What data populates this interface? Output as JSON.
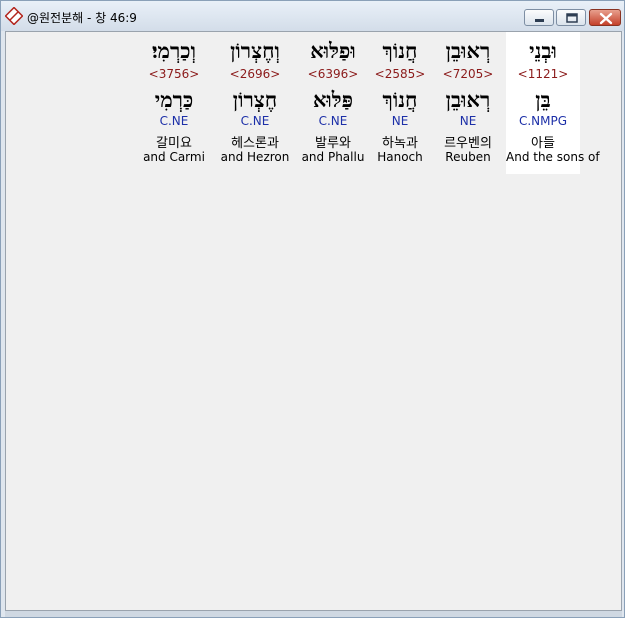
{
  "window": {
    "title": "@원전분해 - 창 46:9"
  },
  "words": [
    {
      "hebrew_top": "וּבְנֵי",
      "strong": "<1121>",
      "hebrew_mid": "בֵּן",
      "parse": "C.NMPG",
      "korean": "아들",
      "english": "And the sons of",
      "selected": true
    },
    {
      "hebrew_top": "רְאוּבֵן",
      "strong": "<7205>",
      "hebrew_mid": "רְאוּבֵן",
      "parse": "NE",
      "korean": "르우벤의",
      "english": "Reuben",
      "selected": false
    },
    {
      "hebrew_top": "חֲנוֹךְ",
      "strong": "<2585>",
      "hebrew_mid": "חֲנוֹךְ",
      "parse": "NE",
      "korean": "하녹과",
      "english": "Hanoch",
      "selected": false
    },
    {
      "hebrew_top": "וּפַלּוּא",
      "strong": "<6396>",
      "hebrew_mid": "פַּלּוּא",
      "parse": "C.NE",
      "korean": "발루와",
      "english": "and Phallu",
      "selected": false
    },
    {
      "hebrew_top": "וְחֶצְרוֹן",
      "strong": "<2696>",
      "hebrew_mid": "חֶצְרוֹן",
      "parse": "C.NE",
      "korean": "헤스론과",
      "english": "and Hezron",
      "selected": false
    },
    {
      "hebrew_top": "וְכַרְמִי׃",
      "strong": "<3756>",
      "hebrew_mid": "כַּרְמִי",
      "parse": "C.NE",
      "korean": "갈미요",
      "english": "and Carmi",
      "selected": false
    }
  ]
}
